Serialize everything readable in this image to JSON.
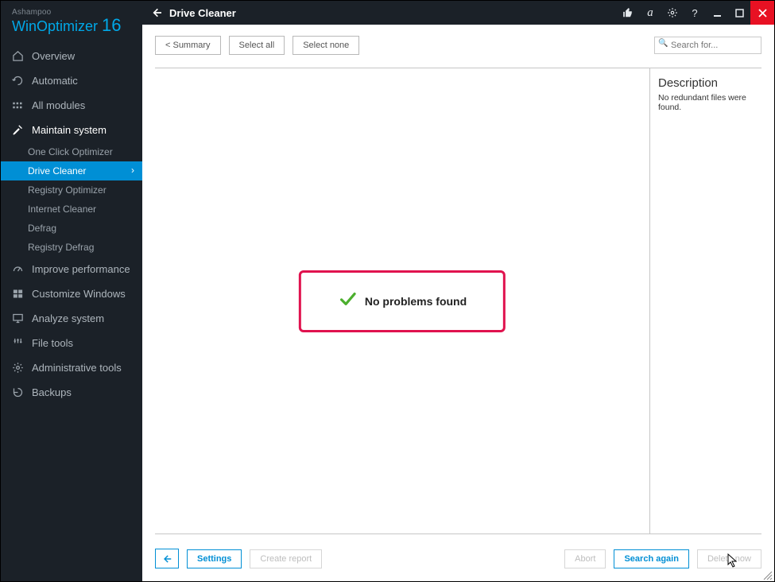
{
  "brand": {
    "company": "Ashampoo",
    "product": "WinOptimizer",
    "version": "16"
  },
  "titlebar": {
    "title": "Drive Cleaner"
  },
  "sidebar": {
    "items": [
      {
        "label": "Overview",
        "icon": "home-icon"
      },
      {
        "label": "Automatic",
        "icon": "refresh-icon"
      },
      {
        "label": "All modules",
        "icon": "grid-icon"
      },
      {
        "label": "Maintain system",
        "icon": "broom-icon",
        "selected": true,
        "subs": [
          {
            "label": "One Click Optimizer"
          },
          {
            "label": "Drive Cleaner",
            "active": true
          },
          {
            "label": "Registry Optimizer"
          },
          {
            "label": "Internet Cleaner"
          },
          {
            "label": "Defrag"
          },
          {
            "label": "Registry Defrag"
          }
        ]
      },
      {
        "label": "Improve performance",
        "icon": "gauge-icon"
      },
      {
        "label": "Customize Windows",
        "icon": "windows-icon"
      },
      {
        "label": "Analyze system",
        "icon": "monitor-icon"
      },
      {
        "label": "File tools",
        "icon": "tools-icon"
      },
      {
        "label": "Administrative tools",
        "icon": "gear-icon"
      },
      {
        "label": "Backups",
        "icon": "backup-icon"
      }
    ]
  },
  "toolbar": {
    "summary": "<  Summary",
    "select_all": "Select all",
    "select_none": "Select none",
    "search_placeholder": "Search for..."
  },
  "description": {
    "title": "Description",
    "text": "No redundant files were found."
  },
  "result": {
    "message": "No problems found"
  },
  "footer": {
    "settings": "Settings",
    "create_report": "Create report",
    "abort": "Abort",
    "search_again": "Search again",
    "delete_now": "Delete now"
  }
}
